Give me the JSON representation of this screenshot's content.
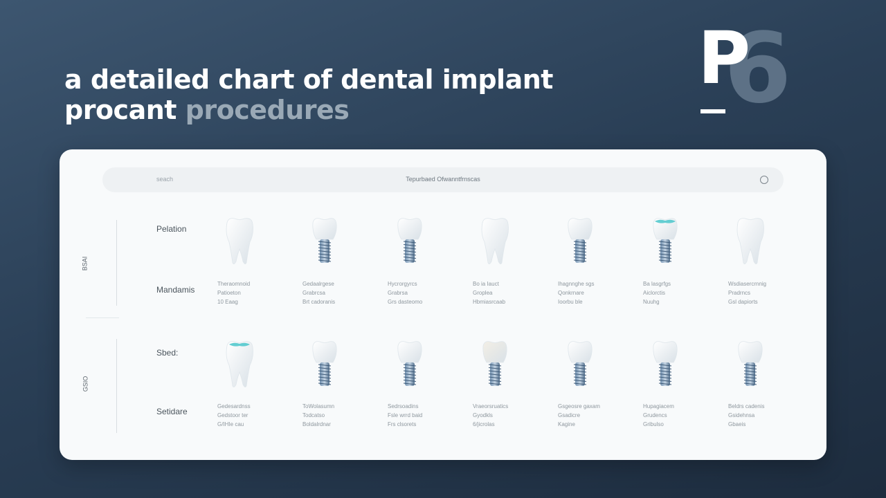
{
  "header": {
    "title_line1": "a detailed chart of dental implant",
    "title_line2_main": "procant",
    "title_line2_muted": "procedures"
  },
  "logo": {
    "letter": "P",
    "digit": "6"
  },
  "chart": {
    "search": {
      "left_label": "seach",
      "center_label": "Tepurbaed Ofwanntfrnscas",
      "icon": "circle-icon"
    },
    "groups": [
      {
        "label": "BSAI",
        "row_labels": [
          "Pelation",
          "Mandamis"
        ],
        "teeth": [
          {
            "type": "natural",
            "crown": "#ffffff",
            "caption": [
              "Theraomnoid",
              "Patioeton",
              "10 Eaag"
            ]
          },
          {
            "type": "implant",
            "crown": "#ffffff",
            "caption": [
              "Gedaalrgese",
              "Grabrcsa",
              "Brt cadoranis"
            ]
          },
          {
            "type": "implant",
            "crown": "#ffffff",
            "caption": [
              "Hycrorgyrcs",
              "Grabrsa",
              "Grs dasteomo"
            ]
          },
          {
            "type": "natural",
            "crown": "#ffffff",
            "caption": [
              "Bo ia Iauct",
              "Groplea",
              "Hbmiasrcaab"
            ]
          },
          {
            "type": "implant",
            "crown": "#ffffff",
            "caption": [
              "Ihagnnghe sgs",
              "Qonkrnare",
              "Ioorbu ble"
            ]
          },
          {
            "type": "implant",
            "crown": "#ffffff",
            "tint": "#3fc3c8",
            "caption": [
              "Ba lasgrfgs",
              "Aiclorctis",
              "Nuuhg"
            ]
          },
          {
            "type": "natural",
            "crown": "#ffffff",
            "caption": [
              "Wsdiasercrnnig",
              "Pradrncs",
              "Gsl dapiorts"
            ]
          }
        ]
      },
      {
        "label": "GSIO",
        "row_labels": [
          "Sbed:",
          "Setidare"
        ],
        "teeth": [
          {
            "type": "natural",
            "crown": "#ffffff",
            "tint": "#3fc3c8",
            "caption": [
              "Gedesardnss",
              "Gedstoor ter",
              "G/IHIe cau"
            ]
          },
          {
            "type": "implant",
            "crown": "#ffffff",
            "caption": [
              "ToWolasumn",
              "Todcatso",
              "Boldalrdnar"
            ]
          },
          {
            "type": "implant",
            "crown": "#ffffff",
            "caption": [
              "Sedrsoadins",
              "Fsle wrrd baid",
              "Frs clsorets"
            ]
          },
          {
            "type": "implant",
            "crown": "#f3efe6",
            "caption": [
              "Vraeorsruatics",
              "Gyodkls",
              "6/jicrolas"
            ]
          },
          {
            "type": "implant",
            "crown": "#ffffff",
            "caption": [
              "Gsgeosre gaxam",
              "Gsadicre",
              "Kagine"
            ]
          },
          {
            "type": "implant",
            "crown": "#ffffff",
            "caption": [
              "Hupagiacem",
              "Grudencs",
              "Gribulso"
            ]
          },
          {
            "type": "implant",
            "crown": "#ffffff",
            "caption": [
              "Beldrs cadenis",
              "Gsidehnsa",
              "Gbaeis"
            ]
          }
        ]
      }
    ]
  }
}
